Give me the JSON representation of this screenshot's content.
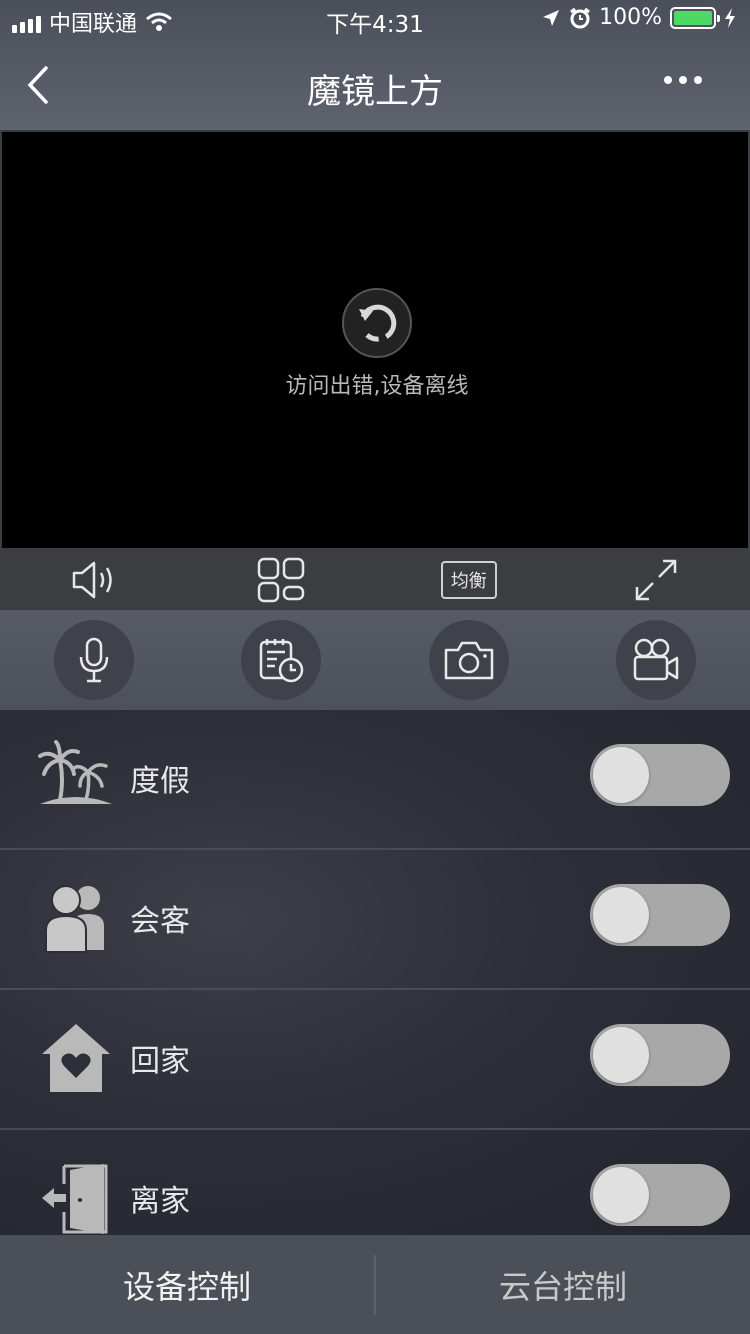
{
  "status_bar": {
    "carrier": "中国联通",
    "time": "下午4:31",
    "battery": "100%",
    "battery_level": 1.0,
    "battery_color": "#4cd964"
  },
  "nav": {
    "title": "魔镜上方",
    "back_icon": "chevron-left-icon",
    "more_icon": "more-dots-icon"
  },
  "video": {
    "message": "访问出错,设备离线",
    "retry_icon": "retry-icon"
  },
  "player_bar": {
    "items": [
      {
        "icon": "speaker-icon"
      },
      {
        "icon": "grid-layout-icon"
      },
      {
        "label": "均衡"
      },
      {
        "icon": "fullscreen-icon"
      }
    ]
  },
  "action_bar": {
    "items": [
      {
        "icon": "microphone-icon"
      },
      {
        "icon": "playback-schedule-icon"
      },
      {
        "icon": "camera-icon"
      },
      {
        "icon": "video-record-icon"
      }
    ]
  },
  "modes": [
    {
      "label": "度假",
      "icon": "palm-tree-icon",
      "on": false
    },
    {
      "label": "会客",
      "icon": "people-icon",
      "on": false
    },
    {
      "label": "回家",
      "icon": "home-heart-icon",
      "on": false
    },
    {
      "label": "离家",
      "icon": "leave-door-icon",
      "on": false
    }
  ],
  "tabs": {
    "device_control": "设备控制",
    "ptz_control": "云台控制"
  },
  "colors": {
    "toggle_off_track": "#a8a8a8",
    "toggle_knob": "#e0e0e0"
  }
}
